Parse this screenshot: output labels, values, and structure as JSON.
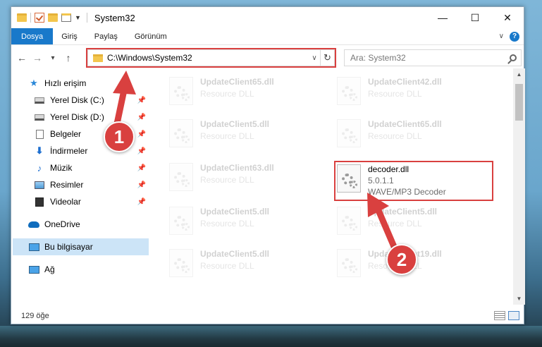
{
  "window": {
    "title": "System32",
    "minimize": "—",
    "maximize": "☐",
    "close": "✕"
  },
  "ribbon": {
    "tabs": [
      "Dosya",
      "Giriş",
      "Paylaş",
      "Görünüm"
    ],
    "expand": "∨",
    "help": "?"
  },
  "nav": {
    "back": "←",
    "forward": "→",
    "recent": "▾",
    "up": "↑",
    "address": "C:\\Windows\\System32",
    "address_dropdown": "∨",
    "refresh": "↻",
    "search_placeholder": "Ara: System32"
  },
  "sidebar": {
    "items": [
      {
        "label": "Hızlı erişim",
        "icon": "star-icon",
        "pinned": false
      },
      {
        "label": "Yerel Disk (C:)",
        "icon": "disk-icon",
        "pinned": true
      },
      {
        "label": "Yerel Disk (D:)",
        "icon": "disk-icon",
        "pinned": true
      },
      {
        "label": "Belgeler",
        "icon": "documents-icon",
        "pinned": true
      },
      {
        "label": "İndirmeler",
        "icon": "download-icon",
        "pinned": true
      },
      {
        "label": "Müzik",
        "icon": "music-icon",
        "pinned": true
      },
      {
        "label": "Resimler",
        "icon": "pictures-icon",
        "pinned": true
      },
      {
        "label": "Videolar",
        "icon": "videos-icon",
        "pinned": true
      },
      {
        "label": "OneDrive",
        "icon": "onedrive-icon",
        "pinned": false
      },
      {
        "label": "Bu bilgisayar",
        "icon": "this-pc-icon",
        "pinned": false,
        "selected": true
      },
      {
        "label": "Ağ",
        "icon": "network-icon",
        "pinned": false
      }
    ],
    "pin_glyph": "📌"
  },
  "files": [
    {
      "name": "UpdateClient65.dll",
      "desc": "Resource DLL",
      "dimmed": true
    },
    {
      "name": "UpdateClient42.dll",
      "desc": "Resource DLL",
      "dimmed": true
    },
    {
      "name": "UpdateClient5.dll",
      "desc": "Resource DLL",
      "dimmed": true
    },
    {
      "name": "UpdateClient65.dll",
      "desc": "Resource DLL",
      "dimmed": true
    },
    {
      "name": "UpdateClient63.dll",
      "desc": "Resource DLL",
      "dimmed": true
    },
    {
      "name": "decoder.dll",
      "version": "5.0.1.1",
      "desc": "WAVE/MP3 Decoder",
      "dimmed": false
    },
    {
      "name": "UpdateClient5.dll",
      "desc": "Resource DLL",
      "dimmed": true
    },
    {
      "name": "UpdateClient5.dll",
      "desc": "Resource DLL",
      "dimmed": true
    },
    {
      "name": "UpdateClient5.dll",
      "desc": "Resource DLL",
      "dimmed": true
    },
    {
      "name": "UpdateClient19.dll",
      "desc": "Resource DLL",
      "dimmed": true
    }
  ],
  "status": {
    "count": "129 öğe"
  },
  "annotations": {
    "step1": "1",
    "step2": "2",
    "color": "#d9403f"
  }
}
